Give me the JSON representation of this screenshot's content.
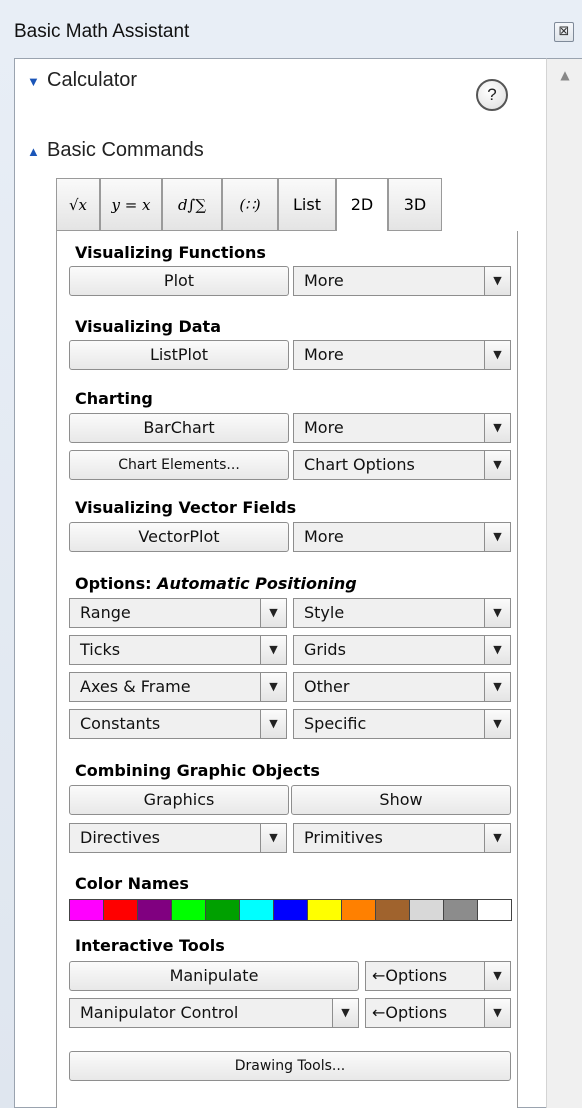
{
  "window": {
    "title": "Basic Math Assistant",
    "close_glyph": "⊠"
  },
  "sections": {
    "calculator": "Calculator",
    "basic_commands": "Basic Commands",
    "help_glyph": "?"
  },
  "tabs": [
    {
      "label": "√x"
    },
    {
      "label": "y = x"
    },
    {
      "label": "d∫∑"
    },
    {
      "label": "(∷)"
    },
    {
      "label": "List"
    },
    {
      "label": "2D"
    },
    {
      "label": "3D"
    }
  ],
  "selected_tab": "2D",
  "groups": {
    "visualizing_functions": {
      "heading": "Visualizing Functions",
      "button": "Plot",
      "more": "More"
    },
    "visualizing_data": {
      "heading": "Visualizing Data",
      "button": "ListPlot",
      "more": "More"
    },
    "charting": {
      "heading": "Charting",
      "button": "BarChart",
      "more": "More",
      "elements": "Chart Elements...",
      "options": "Chart Options"
    },
    "vector_fields": {
      "heading": "Visualizing Vector Fields",
      "button": "VectorPlot",
      "more": "More"
    },
    "options": {
      "heading_prefix": "Options: ",
      "heading_italic": "Automatic Positioning",
      "range": "Range",
      "style": "Style",
      "ticks": "Ticks",
      "grids": "Grids",
      "axes": "Axes & Frame",
      "other": "Other",
      "constants": "Constants",
      "specific": "Specific"
    },
    "combining": {
      "heading": "Combining Graphic Objects",
      "graphics": "Graphics",
      "show": "Show",
      "directives": "Directives",
      "primitives": "Primitives"
    },
    "colors": {
      "heading": "Color Names",
      "swatches": [
        "#ff00ff",
        "#ff0000",
        "#800080",
        "#00ff00",
        "#00a000",
        "#00ffff",
        "#0000ff",
        "#ffff00",
        "#ff8000",
        "#a0632d",
        "#d8d8d8",
        "#8c8c8c",
        "#ffffff"
      ]
    },
    "interactive": {
      "heading": "Interactive Tools",
      "manipulate": "Manipulate",
      "options1": "←Options",
      "manip_control": "Manipulator Control",
      "options2": "←Options",
      "drawing": "Drawing Tools..."
    }
  },
  "dropdown_arrow": "▼",
  "scroll_arrow": "▲"
}
